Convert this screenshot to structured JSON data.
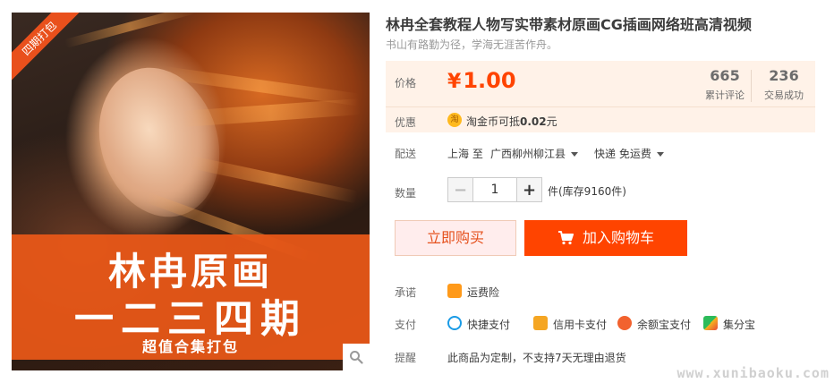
{
  "image": {
    "ribbon": "四期打包",
    "banner_title_1": "林冉原画",
    "banner_title_2": "一二三四期",
    "banner_sub": "超值合集打包"
  },
  "product": {
    "title": "林冉全套教程人物写实带素材原画CG插画网络班高清视频",
    "subtitle": "书山有路勤为径，学海无涯苦作舟。"
  },
  "price": {
    "label": "价格",
    "currency": "¥",
    "value": "1.00",
    "reviews_count": "665",
    "reviews_label": "累计评论",
    "deals_count": "236",
    "deals_label": "交易成功"
  },
  "promo": {
    "label": "优惠",
    "coin_icon_char": "淘",
    "coin_text_prefix": "淘金币可抵",
    "coin_amount": "0.02",
    "coin_text_suffix": "元"
  },
  "delivery": {
    "label": "配送",
    "from": "上海",
    "to_word": "至",
    "destination": "广西柳州柳江县",
    "shipping": "快递 免运费"
  },
  "quantity": {
    "label": "数量",
    "value": "1",
    "minus": "−",
    "plus": "+",
    "stock": "件(库存9160件)"
  },
  "actions": {
    "buy_now": "立即购买",
    "add_cart": "加入购物车"
  },
  "guarantee": {
    "label": "承诺",
    "item": "运费险"
  },
  "payment": {
    "label": "支付",
    "methods": [
      "快捷支付",
      "信用卡支付",
      "余额宝支付",
      "集分宝"
    ]
  },
  "notice": {
    "label": "提醒",
    "text": "此商品为定制，不支持7天无理由退货"
  },
  "watermark": "www.xunibaoku.com",
  "colors": {
    "accent": "#ff4400",
    "price": "#ff4400",
    "price_bg": "#fff2e8",
    "banner": "#eb5818"
  }
}
